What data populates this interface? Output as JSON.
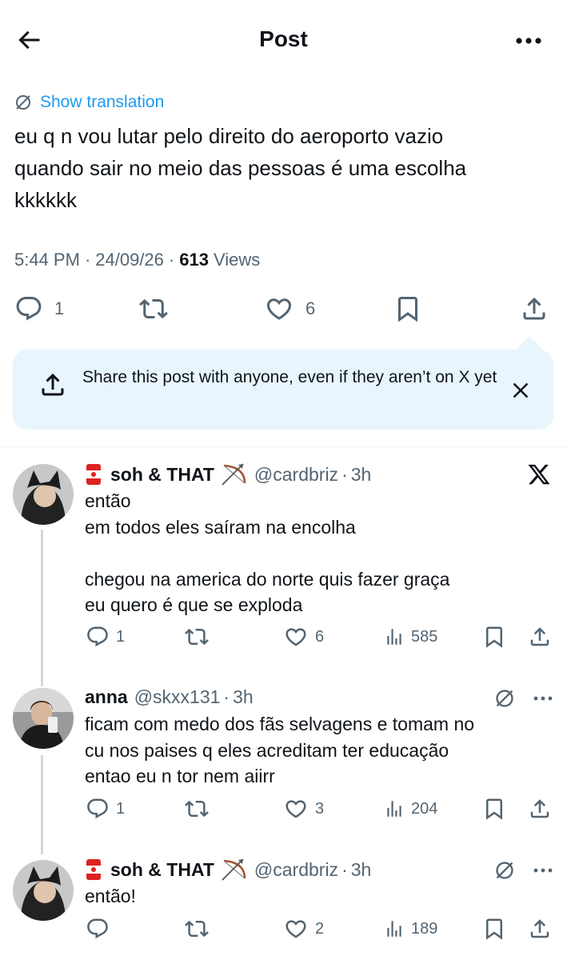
{
  "header": {
    "title": "Post"
  },
  "post": {
    "show_translation": "Show translation",
    "text": "eu q n vou lutar pelo direito do aeroporto vazio\nquando sair no meio das pessoas é uma escolha\nkkkkkk",
    "time": "5:44 PM",
    "sep1": "·",
    "date": "24/09/26",
    "sep2": "·",
    "views_count": "613",
    "views_label": "Views",
    "replies": "1",
    "likes": "6"
  },
  "share_prompt": {
    "text": "Share this post with anyone, even if they aren’t on X yet"
  },
  "replies": [
    {
      "name": "soh & THAT",
      "handle": "@cardbriz",
      "dot": "·",
      "time": "3h",
      "text": "então\nem todos eles saíram na encolha\n\nchegou na america do norte quis fazer graça\neu quero é que se exploda",
      "replies": "1",
      "likes": "6",
      "views": "585"
    },
    {
      "name": "anna",
      "handle": "@skxx131",
      "dot": "·",
      "time": "3h",
      "text": "ficam com medo dos fãs selvagens e tomam no\ncu nos paises q eles acreditam ter educação\nentao eu n tor nem aiirr",
      "replies": "1",
      "likes": "3",
      "views": "204"
    },
    {
      "name": "soh & THAT",
      "handle": "@cardbriz",
      "dot": "·",
      "time": "3h",
      "text": "então!",
      "replies": "",
      "likes": "2",
      "views": "189"
    }
  ],
  "colors": {
    "accent": "#1d9bf0",
    "muted": "#536471",
    "text": "#0f1419",
    "share_bg": "#e8f5fd"
  },
  "icons": [
    "back-arrow-icon",
    "more-icon",
    "translate-icon",
    "reply-icon",
    "repost-icon",
    "like-icon",
    "bookmark-icon",
    "share-icon",
    "close-icon",
    "x-logo-icon",
    "views-icon",
    "can-emoji-icon",
    "bow-arrow-emoji-icon"
  ]
}
